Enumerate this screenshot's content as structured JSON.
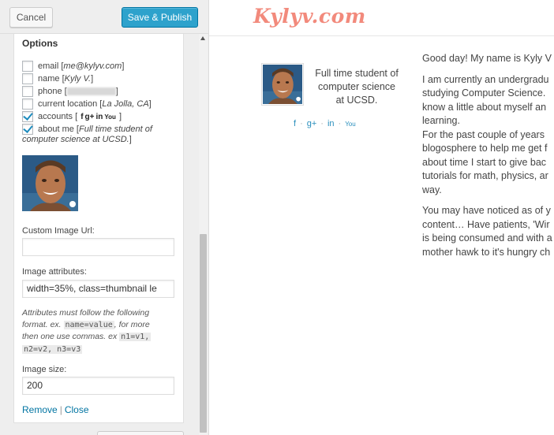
{
  "header": {
    "cancel_label": "Cancel",
    "save_label": "Save & Publish"
  },
  "widget": {
    "options_title": "Options",
    "checkboxes": [
      {
        "name": "email",
        "value": "me@kylyv.com",
        "checked": false
      },
      {
        "name": "name",
        "value": "Kyly V.",
        "checked": false
      },
      {
        "name": "phone",
        "value": "",
        "checked": false
      },
      {
        "name": "current location",
        "value": "La Jolla, CA",
        "checked": false
      },
      {
        "name": "accounts",
        "value": "",
        "checked": true
      },
      {
        "name": "about me",
        "value": "Full time student of",
        "checked": true
      }
    ],
    "aboutme_line2": "computer science at UCSD.",
    "aboutme_line2_close": "]",
    "accounts_icons": [
      "f",
      "g+",
      "in",
      "You"
    ],
    "custom_url_label": "Custom Image Url:",
    "custom_url_value": "",
    "image_attr_label": "Image attributes:",
    "image_attr_value": "width=35%, class=thumbnail le",
    "help_line1": "Attributes must follow the following",
    "help_line2_pre": "format. ex.",
    "help_code1": "name=value",
    "help_line2_post": ", for more",
    "help_line3_pre": "then one use commas. ex",
    "help_code2": "n1=v1,",
    "help_code3": "n2=v2, n3=v3",
    "image_size_label": "Image size:",
    "image_size_value": "200",
    "remove_label": "Remove",
    "separator": "|",
    "close_label": "Close"
  },
  "preview": {
    "logo": "Kylyv.com",
    "bio_text": "Full time student of computer science at UCSD.",
    "social": [
      "f",
      "g+",
      "in",
      "You"
    ],
    "article_lines": [
      "Good day! My name is Kyly V",
      "",
      "I am currently an undergradu",
      "studying Computer Science.",
      "know a little about myself an",
      "learning.",
      "For the past couple of years",
      "blogosphere to help me get f",
      "about time I start to give bac",
      "tutorials for math, physics, ar",
      "way.",
      "",
      "You may have noticed as of y",
      "content… Have patients, 'Wir",
      "is being consumed and with a",
      "mother hawk to it's hungry ch"
    ]
  },
  "colors": {
    "accent": "#2ea2cc",
    "link": "#0074a2",
    "logo": "#f28a7c"
  }
}
